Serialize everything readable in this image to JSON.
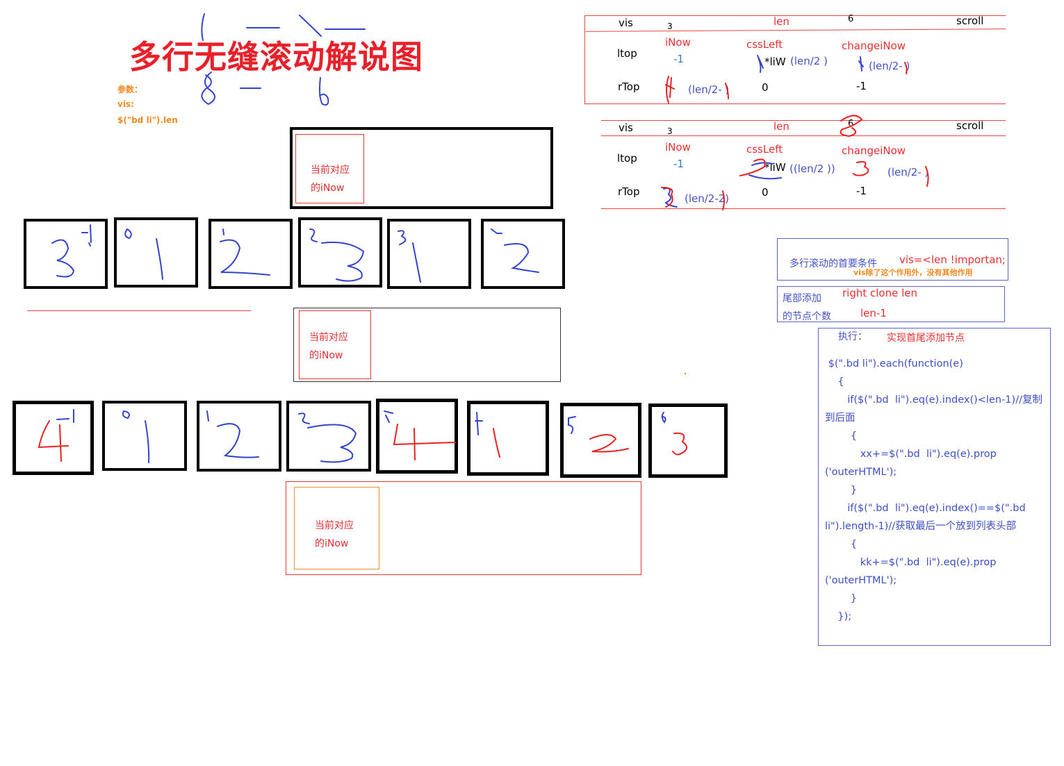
{
  "title": "多行无缝滚动解说图",
  "params": {
    "label": "参数：",
    "vis": "vis:",
    "len": "$(\"bd li\").len"
  },
  "inow_box": {
    "line1": "当前对应",
    "line2": "的iNow"
  },
  "table1": {
    "vis": "vis",
    "vis_val": "3",
    "len": "len",
    "len_val": "6",
    "scroll": "scroll",
    "ltop": "ltop",
    "inow": "iNow",
    "inow_val": "-1",
    "cssleft": "cssLeft",
    "cssleft_val": "*liW",
    "cssleft_expr": "(len/2   )",
    "changeinow": "changeiNow",
    "changeinow_expr": "(len/2-  )",
    "rtop": "rTop",
    "rtop_expr": "(len/2-  )",
    "rtop_mid": "0",
    "rtop_right": "-1"
  },
  "table2": {
    "vis": "vis",
    "vis_val": "3",
    "len": "len",
    "len_val": "6",
    "scroll": "scroll",
    "ltop": "ltop",
    "inow": "iNow",
    "inow_val": "-1",
    "cssleft": "cssLeft",
    "cssleft_val": "*liW",
    "cssleft_expr": "((len/2   ))",
    "changeinow": "changeiNow",
    "changeinow_expr": "(len/2-  )",
    "rtop": "rTop",
    "rtop_expr": "(len/2-2)",
    "rtop_mid": "0",
    "rtop_right": "-1"
  },
  "cond": {
    "label": "多行滚动的首要条件",
    "rule": "vis=<len !importan;",
    "note": "vis除了这个作用外，没有其他作用"
  },
  "tail": {
    "label1": "尾部添加",
    "label2": "的节点个数",
    "right": "right  clone  len",
    "count": "len-1"
  },
  "exec": {
    "label": "执行：",
    "desc": "实现首尾添加节点",
    "code": [
      " $(\".bd li\").each(function(e)",
      "    {",
      "       if($(\".bd  li\").eq(e).index()<len-1)//复制",
      "到后面",
      "        {",
      "           xx+=$(\".bd  li\").eq(e).prop",
      "('outerHTML');",
      "        }",
      "       if($(\".bd  li\").eq(e).index()==$(\".bd",
      "li\").length-1)//获取最后一个放到列表头部",
      "        {",
      "           kk+=$(\".bd  li\").eq(e).prop",
      "('outerHTML');",
      "        }",
      "    });"
    ]
  },
  "colors": {
    "red": "#e83030",
    "blue": "#4452c8",
    "orange": "#f08a24"
  }
}
